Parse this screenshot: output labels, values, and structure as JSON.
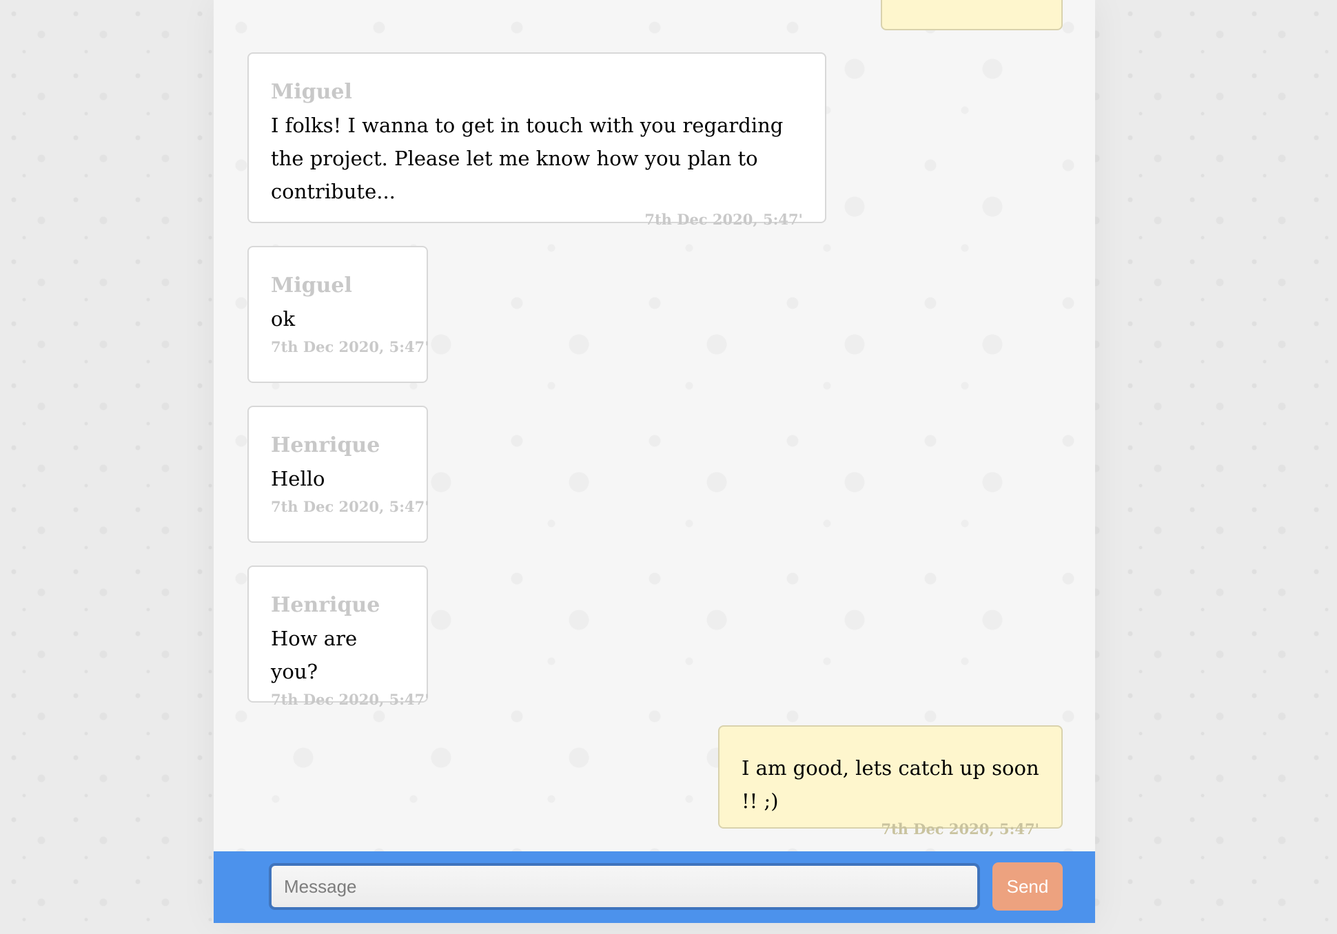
{
  "messages": [
    {
      "sender": "",
      "text": "",
      "time": "",
      "mine": true
    },
    {
      "sender": "Miguel",
      "text": "I folks! I wanna to get in touch with you regarding the project. Please let me know how you plan to contribute...",
      "time": "7th Dec 2020, 5:47'",
      "mine": false
    },
    {
      "sender": "Miguel",
      "text": "ok",
      "time": "7th Dec 2020, 5:47'",
      "mine": false
    },
    {
      "sender": "Henrique",
      "text": "Hello",
      "time": "7th Dec 2020, 5:47'",
      "mine": false
    },
    {
      "sender": "Henrique",
      "text": "How are you?",
      "time": "7th Dec 2020, 5:47'",
      "mine": false
    },
    {
      "sender": "",
      "text": "I am good, lets catch up soon !! ;)",
      "time": "7th Dec 2020, 5:47'",
      "mine": true
    }
  ],
  "composer": {
    "placeholder": "Message",
    "value": "",
    "send_label": "Send"
  },
  "colors": {
    "input_bar": "#4c92ec",
    "send_button": "#eda27f",
    "own_bubble": "#fef6cd",
    "other_bubble": "#ffffff"
  }
}
